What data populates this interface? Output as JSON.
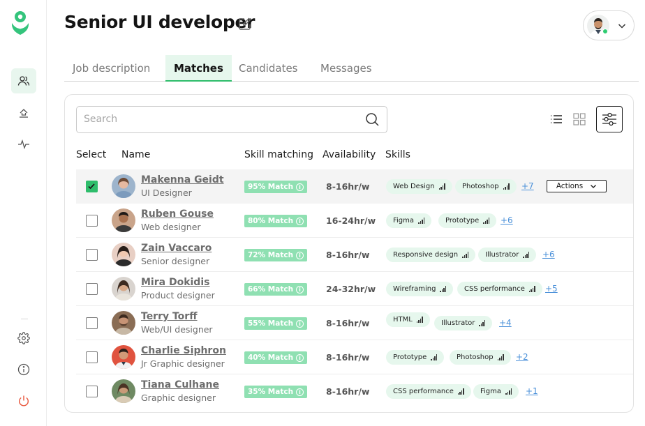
{
  "page": {
    "title": "Senior UI developer"
  },
  "tabs": [
    {
      "label": "Job description",
      "active": false
    },
    {
      "label": "Matches",
      "active": true
    },
    {
      "label": "Candidates",
      "active": false
    },
    {
      "label": "Messages",
      "active": false
    }
  ],
  "search": {
    "placeholder": "Search"
  },
  "columns": {
    "select": "Select",
    "name": "Name",
    "skill_matching": "Skill matching",
    "availability": "Availability",
    "skills": "Skills"
  },
  "actions_label": "Actions",
  "candidates": [
    {
      "name": "Makenna Geidt",
      "role": "UI Designer",
      "match": "95% Match",
      "availability": "8-16hr/w",
      "selected": true,
      "skills": [
        "Web Design",
        "Photoshop"
      ],
      "more": "+7"
    },
    {
      "name": "Ruben Gouse",
      "role": "Web designer",
      "match": "80% Match",
      "availability": "16-24hr/w",
      "selected": false,
      "skills": [
        "Figma",
        "Prototype"
      ],
      "more": "+6"
    },
    {
      "name": "Zain Vaccaro",
      "role": "Senior designer",
      "match": "72% Match",
      "availability": "8-16hr/w",
      "selected": false,
      "skills": [
        "Responsive design",
        "Illustrator"
      ],
      "more": "+6"
    },
    {
      "name": "Mira Dokidis",
      "role": "Product designer",
      "match": "66% Match",
      "availability": "24-32hr/w",
      "selected": false,
      "skills": [
        "Wireframing",
        "CSS performance"
      ],
      "more": "+5"
    },
    {
      "name": "Terry Torff",
      "role": "Web/UI designer",
      "match": "55% Match",
      "availability": "8-16hr/w",
      "selected": false,
      "skills": [
        "HTML",
        "Illustrator"
      ],
      "more": "+4"
    },
    {
      "name": "Charlie Siphron",
      "role": "Jr Graphic designer",
      "match": "40% Match",
      "availability": "8-16hr/w",
      "selected": false,
      "skills": [
        "Prototype",
        "Photoshop"
      ],
      "more": "+2"
    },
    {
      "name": "Tiana Culhane",
      "role": "Graphic designer",
      "match": "35% Match",
      "availability": "8-16hr/w",
      "selected": false,
      "skills": [
        "CSS performance",
        "Figma"
      ],
      "more": "+1"
    }
  ],
  "colors": {
    "accent": "#2ebd6b",
    "accent_light": "#e6f7ed",
    "match_badge": "#8fe0b2",
    "link": "#4a90d9",
    "logout": "#e8553b"
  },
  "icons": {
    "sidebar": [
      "people-icon",
      "upload-icon",
      "activity-icon",
      "gear-icon",
      "info-icon",
      "power-icon"
    ],
    "views": [
      "list-view-icon",
      "grid-view-icon",
      "filter-sliders-icon"
    ]
  }
}
